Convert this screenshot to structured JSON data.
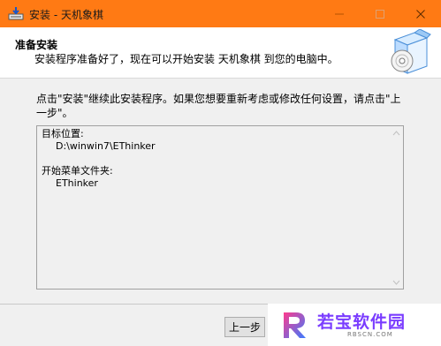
{
  "window": {
    "title": "安装 - 天机象棋",
    "accent": "#ff7a14",
    "controls": [
      "minimize-icon",
      "maximize-icon",
      "close-icon"
    ]
  },
  "header": {
    "title": "准备安装",
    "subtitle": "安装程序准备好了，现在可以开始安装 天机象棋 到您的电脑中。",
    "art_icon": "software-box-cd-icon"
  },
  "body": {
    "description": "点击\"安装\"继续此安装程序。如果您想要重新考虑或修改任何设置，请点击\"上一步\"。",
    "info": {
      "dest_label": "目标位置:",
      "dest_value": "D:\\winwin7\\EThinker",
      "menu_label": "开始菜单文件夹:",
      "menu_value": "EThinker"
    }
  },
  "footer": {
    "back_label": "上一步"
  },
  "watermark": {
    "title": "若宝软件园",
    "url": "RBSCN.COM",
    "color": "#7a3cff"
  }
}
